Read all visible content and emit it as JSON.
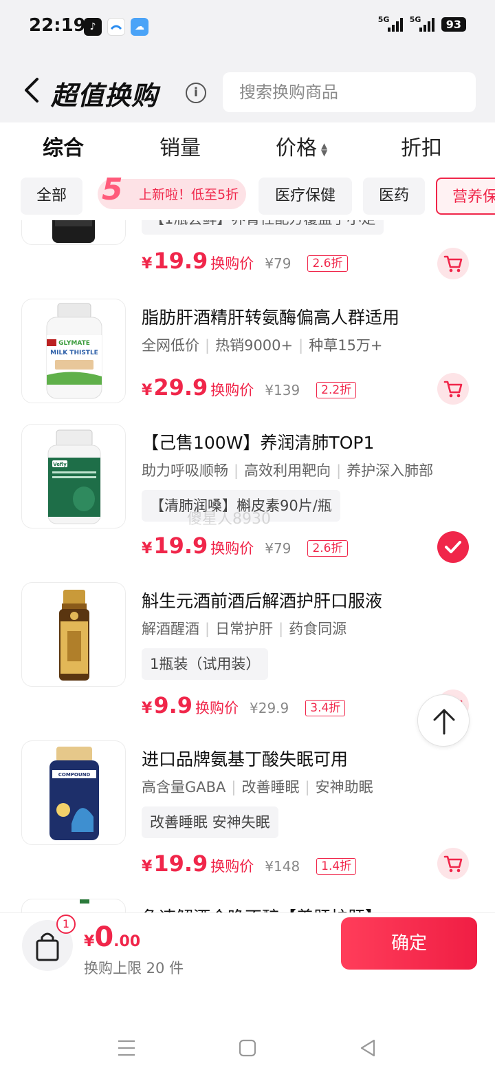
{
  "status_bar": {
    "time": "22:19",
    "network_1": "5G",
    "network_2": "5G",
    "battery": "93"
  },
  "header": {
    "title": "超值换购",
    "search_placeholder": "搜索换购商品"
  },
  "sort_tabs": [
    {
      "label": "综合",
      "active": true
    },
    {
      "label": "销量",
      "active": false
    },
    {
      "label": "价格",
      "active": false
    },
    {
      "label": "折扣",
      "active": false
    }
  ],
  "categories": {
    "all": "全部",
    "promo": "上新啦！低至5折",
    "medical_care": "医疗保健",
    "medicine": "医药",
    "nutrition": "营养保"
  },
  "products": [
    {
      "title_partial": "【1瓶尝鲜】养肾性配方覆盖手小足",
      "price": "19.9",
      "price_label": "换购价",
      "original_price": "¥79",
      "discount": "2.6折",
      "selected": false
    },
    {
      "title": "脂肪肝酒精肝转氨酶偏高人群适用",
      "tags": [
        "全网低价",
        "热销9000+",
        "种草15万+"
      ],
      "price": "29.9",
      "price_label": "换购价",
      "original_price": "¥139",
      "discount": "2.2折",
      "selected": false,
      "thumb_brand": "GLYMATE",
      "thumb_product": "MILK THISTLE"
    },
    {
      "title": "【己售100W】养润清肺TOP1",
      "tags": [
        "助力呼吸顺畅",
        "高效利用靶向",
        "养护深入肺部"
      ],
      "spec": "【清肺润嗓】槲皮素90片/瓶",
      "price": "19.9",
      "price_label": "换购价",
      "original_price": "¥79",
      "discount": "2.6折",
      "selected": true,
      "thumb_brand": "Vefly"
    },
    {
      "title": "斛生元酒前酒后解酒护肝口服液",
      "tags": [
        "解酒醒酒",
        "日常护肝",
        "药食同源"
      ],
      "spec": "1瓶装（试用装）",
      "price": "9.9",
      "price_label": "换购价",
      "original_price": "¥29.9",
      "discount": "3.4折",
      "selected": false
    },
    {
      "title": "进口品牌氨基丁酸失眠可用",
      "tags": [
        "高含量GABA",
        "改善睡眠",
        "安神助眠"
      ],
      "spec": "改善睡眠 安神失眠",
      "price": "19.9",
      "price_label": "换购价",
      "original_price": "¥148",
      "discount": "1.4折",
      "selected": false,
      "thumb_product": "COMPOUND"
    },
    {
      "title_partial": "急速解酒合晚不醉【养肝护肝】"
    }
  ],
  "watermark": "傻星人8930",
  "bottom_bar": {
    "cart_count": "1",
    "currency": "¥",
    "total_int": "0",
    "total_dec": ".00",
    "limit_text": "换购上限 20 件",
    "confirm_label": "确定"
  },
  "colors": {
    "accent": "#f0264a",
    "header_bg": "#f2f2f4"
  }
}
